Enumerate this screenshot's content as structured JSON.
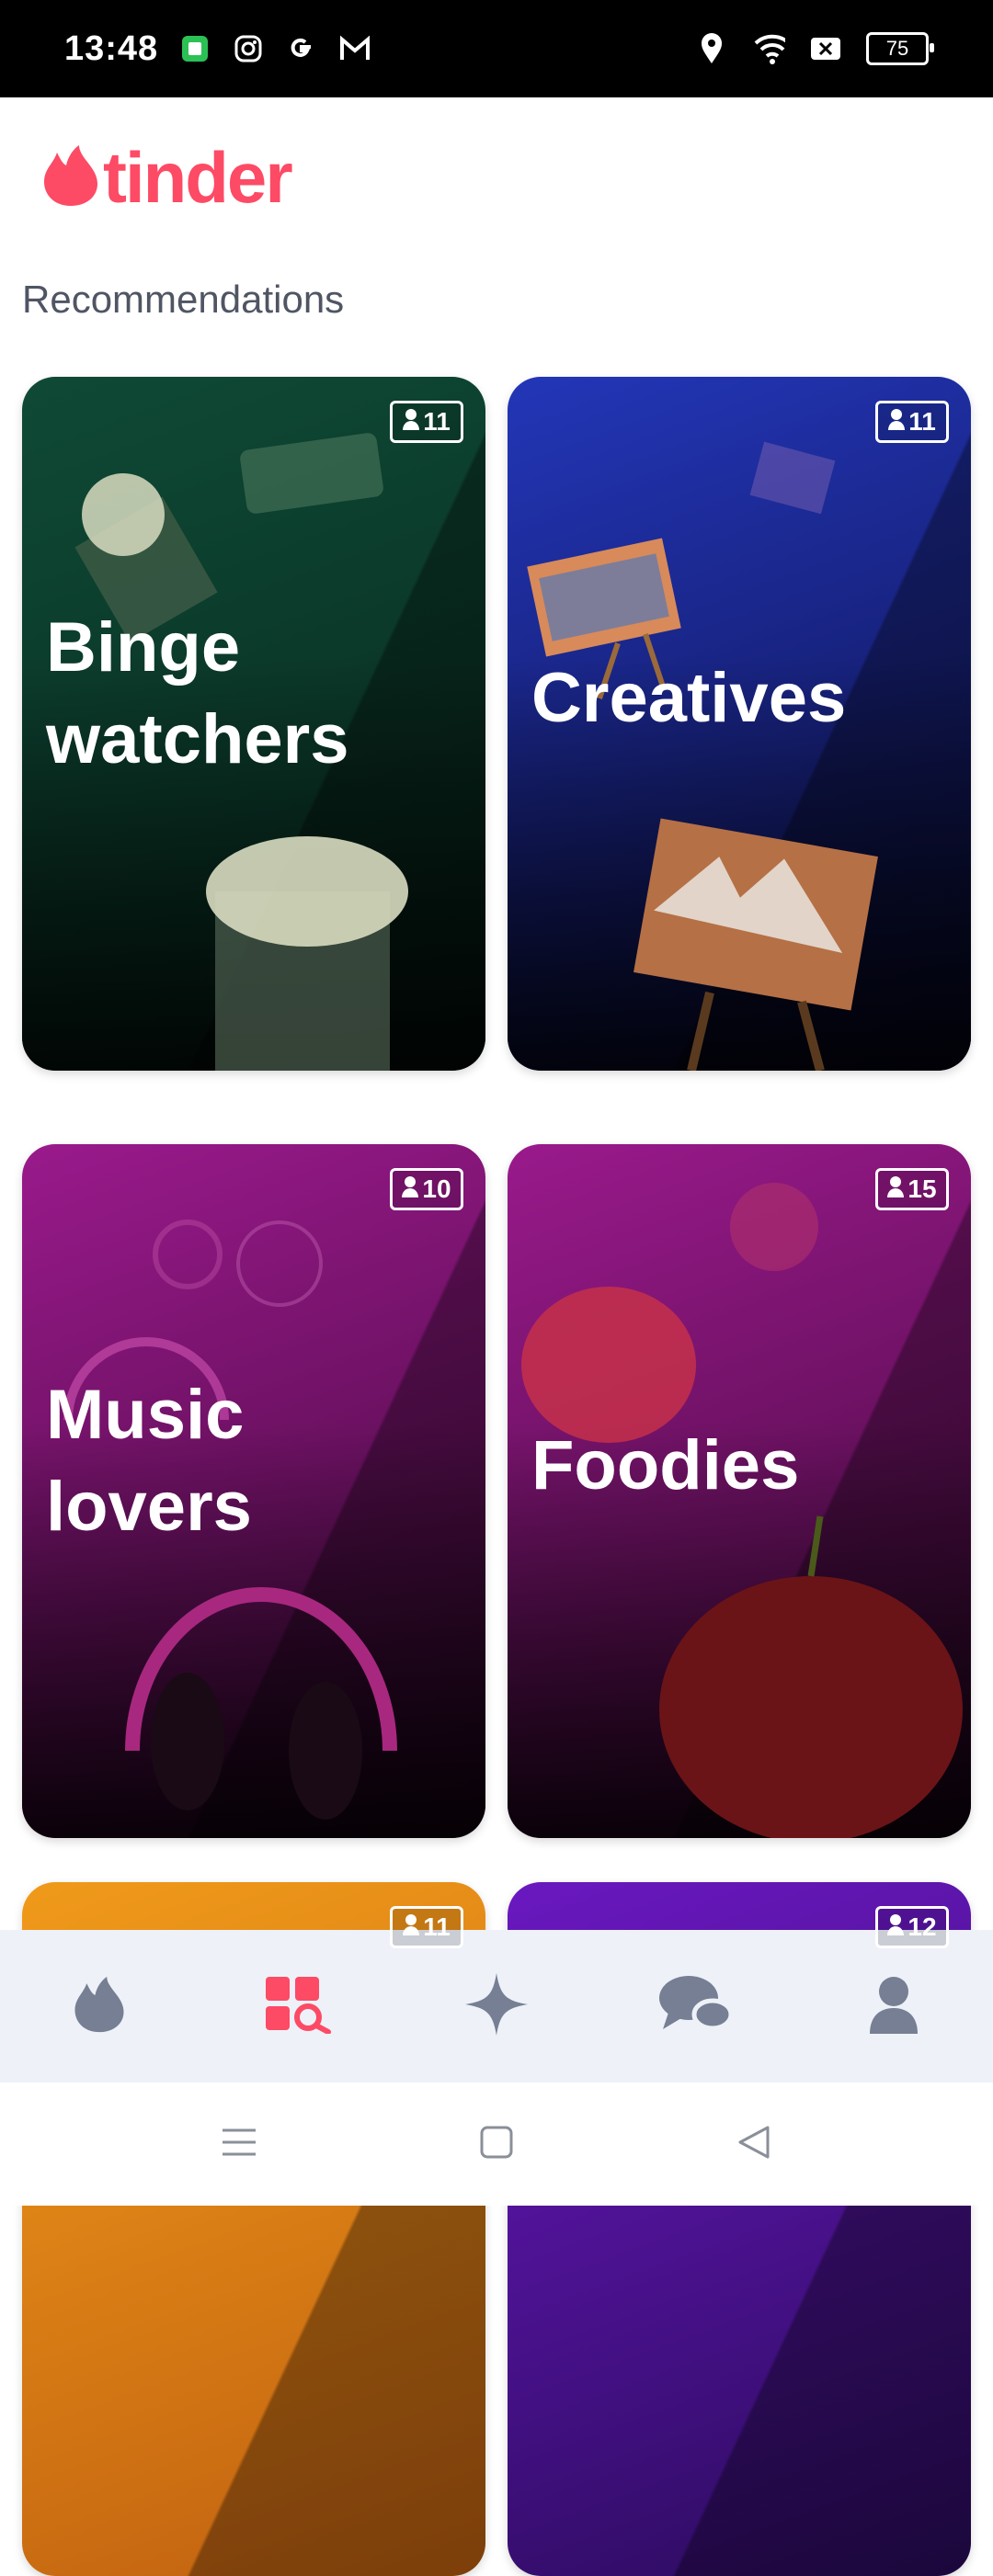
{
  "status_bar": {
    "time": "13:48",
    "battery": "75",
    "icons": [
      "sim-icon",
      "instagram-icon",
      "google-icon",
      "gmail-icon",
      "location-icon",
      "wifi-icon",
      "mute-icon",
      "battery-icon"
    ]
  },
  "header": {
    "logo_text": "tinder"
  },
  "section": {
    "title": "Recommendations"
  },
  "cards": [
    {
      "title": "Binge watchers",
      "count": "11",
      "colors": [
        "#0e3a2c",
        "#0a1f18"
      ]
    },
    {
      "title": "Creatives",
      "count": "11",
      "colors": [
        "#1b2aa0",
        "#0a0c3a"
      ]
    },
    {
      "title": "Music lovers",
      "count": "10",
      "colors": [
        "#8a1a7e",
        "#3a0734"
      ]
    },
    {
      "title": "Foodies",
      "count": "15",
      "colors": [
        "#8a1a7e",
        "#3a0734"
      ]
    },
    {
      "title": "",
      "count": "11",
      "colors": [
        "#e8870f",
        "#b5560b"
      ]
    },
    {
      "title": "",
      "count": "12",
      "colors": [
        "#5a13a8",
        "#2a0b5c"
      ]
    }
  ],
  "bottom_nav": {
    "items": [
      "flame-icon",
      "explore-icon",
      "sparkle-icon",
      "chat-icon",
      "profile-icon"
    ],
    "active_color": "#fd4a65",
    "inactive_color": "#767f93"
  },
  "system_nav": [
    "menu-icon",
    "home-icon",
    "back-icon"
  ]
}
